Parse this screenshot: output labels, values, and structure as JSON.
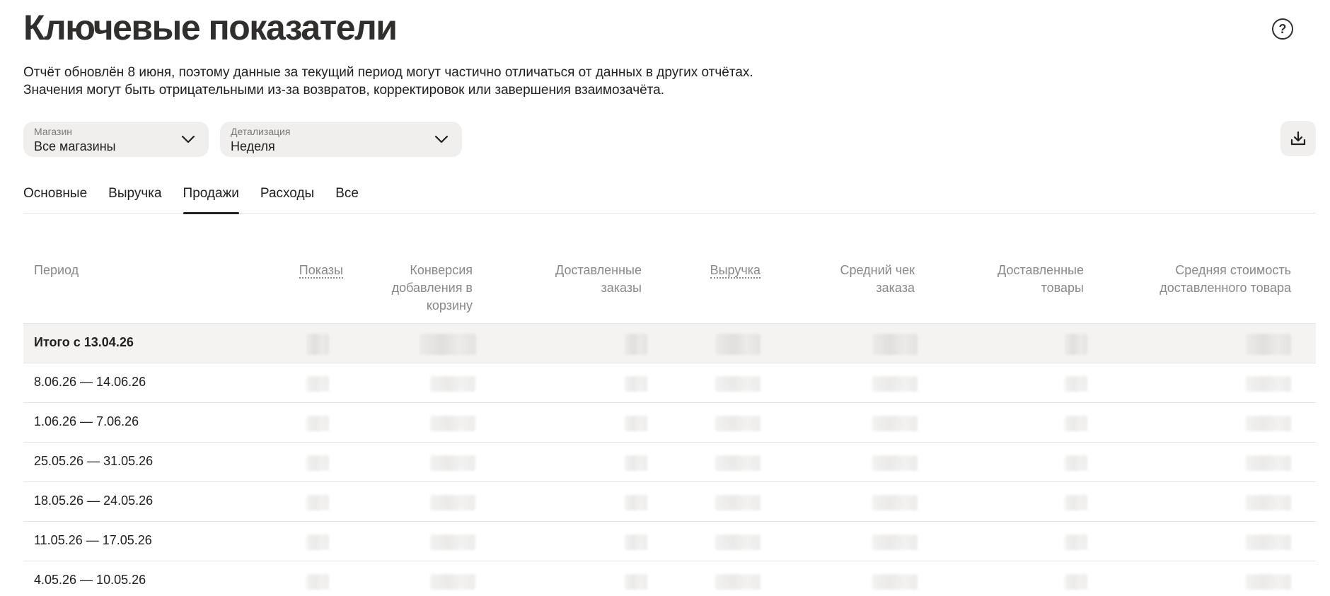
{
  "header": {
    "title": "Ключевые показатели",
    "notice": "Отчёт обновлён 8 июня, поэтому данные за текущий период могут частично отличаться от данных в других отчётах. Значения могут быть отрицательными из-за возвратов, корректировок или завершения взаимозачёта.",
    "help_icon": "question-circle-icon",
    "help_glyph": "?"
  },
  "filters": {
    "shop": {
      "label": "Магазин",
      "value": "Все магазины",
      "icon": "chevron-down-icon"
    },
    "detail": {
      "label": "Детализация",
      "value": "Неделя",
      "icon": "chevron-down-icon"
    },
    "download_icon": "download-icon"
  },
  "tabs": [
    {
      "label": "Основные",
      "active": false
    },
    {
      "label": "Выручка",
      "active": false
    },
    {
      "label": "Продажи",
      "active": true
    },
    {
      "label": "Расходы",
      "active": false
    },
    {
      "label": "Все",
      "active": false
    }
  ],
  "table": {
    "columns": [
      "Период",
      "Показы",
      "Конверсия добавления в корзину",
      "Доставленные заказы",
      "Выручка",
      "Средний чек заказа",
      "Доставленные товары",
      "Средняя стоимость доставленного товара"
    ],
    "rows": [
      {
        "period": "Итого с 13.04.26",
        "total": true
      },
      {
        "period": "8.06.26 — 14.06.26"
      },
      {
        "period": "1.06.26 — 7.06.26"
      },
      {
        "period": "25.05.26 — 31.05.26"
      },
      {
        "period": "18.05.26 — 24.05.26"
      },
      {
        "period": "11.05.26 — 17.05.26"
      },
      {
        "period": "4.05.26 — 10.05.26"
      }
    ]
  }
}
